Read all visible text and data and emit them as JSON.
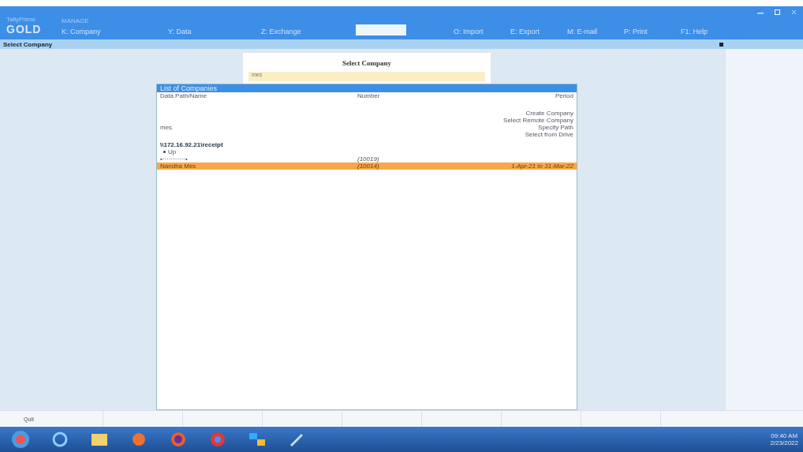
{
  "app": {
    "brand": "TallyPrime",
    "edition": "GOLD",
    "sub": "MANAGE"
  },
  "menu": [
    {
      "label": "K: Company"
    },
    {
      "label": "Y: Data"
    },
    {
      "label": "Z: Exchange"
    }
  ],
  "menu_right": [
    {
      "label": "O: Import"
    },
    {
      "label": "E: Export"
    },
    {
      "label": "M: E-mail"
    },
    {
      "label": "P: Print"
    },
    {
      "label": "F1: Help"
    }
  ],
  "screen_title": "Select Company",
  "dialog": {
    "title": "Select Company",
    "value": "mes"
  },
  "list": {
    "title": "List of Companies",
    "columns": [
      "Data Path/Name",
      "Number",
      "Period"
    ],
    "actions": [
      "Create Company",
      "Select Remote Company",
      "Specify Path",
      "Select from Drive"
    ],
    "filter": "mes",
    "rows": [
      {
        "kind": "path",
        "name": "\\\\172.16.92.21\\receipt"
      },
      {
        "kind": "up",
        "name": "Up"
      },
      {
        "kind": "company",
        "name": "•···········•",
        "number": "(10019)",
        "selected": false
      },
      {
        "kind": "company",
        "name": "Nandha Mes",
        "number": "(10014)",
        "period": "1-Apr-21 to 31-Mar-22",
        "selected": true
      }
    ]
  },
  "bottom": [
    {
      "label": "Quit"
    }
  ],
  "clock": {
    "time": "09:40 AM",
    "date": "2/23/2022"
  }
}
